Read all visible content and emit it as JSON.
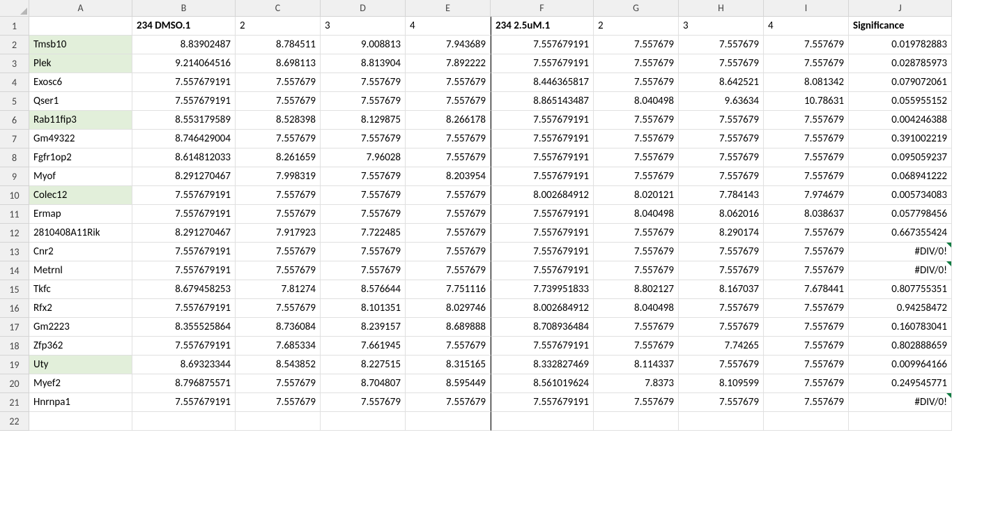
{
  "columns": [
    "A",
    "B",
    "C",
    "D",
    "E",
    "F",
    "G",
    "H",
    "I",
    "J"
  ],
  "headers": {
    "A": "",
    "B": "234 DMSO.1",
    "C": "2",
    "D": "3",
    "E": "4",
    "F": "234 2.5uM.1",
    "G": "2",
    "H": "3",
    "I": "4",
    "J": "Significance"
  },
  "header_bold": [
    "B",
    "F",
    "J"
  ],
  "rows": [
    {
      "n": 2,
      "hl": true,
      "A": "Tmsb10",
      "B": "8.83902487",
      "C": "8.784511",
      "D": "9.008813",
      "E": "7.943689",
      "F": "7.557679191",
      "G": "7.557679",
      "H": "7.557679",
      "I": "7.557679",
      "J": "0.019782883"
    },
    {
      "n": 3,
      "hl": true,
      "A": "Plek",
      "B": "9.214064516",
      "C": "8.698113",
      "D": "8.813904",
      "E": "7.892222",
      "F": "7.557679191",
      "G": "7.557679",
      "H": "7.557679",
      "I": "7.557679",
      "J": "0.028785973"
    },
    {
      "n": 4,
      "A": "Exosc6",
      "B": "7.557679191",
      "C": "7.557679",
      "D": "7.557679",
      "E": "7.557679",
      "F": "8.446365817",
      "G": "7.557679",
      "H": "8.642521",
      "I": "8.081342",
      "J": "0.079072061"
    },
    {
      "n": 5,
      "A": "Qser1",
      "B": "7.557679191",
      "C": "7.557679",
      "D": "7.557679",
      "E": "7.557679",
      "F": "8.865143487",
      "G": "8.040498",
      "H": "9.63634",
      "I": "10.78631",
      "J": "0.055955152"
    },
    {
      "n": 6,
      "hl": true,
      "A": "Rab11fip3",
      "B": "8.553179589",
      "C": "8.528398",
      "D": "8.129875",
      "E": "8.266178",
      "F": "7.557679191",
      "G": "7.557679",
      "H": "7.557679",
      "I": "7.557679",
      "J": "0.004246388"
    },
    {
      "n": 7,
      "A": "Gm49322",
      "B": "8.746429004",
      "C": "7.557679",
      "D": "7.557679",
      "E": "7.557679",
      "F": "7.557679191",
      "G": "7.557679",
      "H": "7.557679",
      "I": "7.557679",
      "J": "0.391002219"
    },
    {
      "n": 8,
      "A": "Fgfr1op2",
      "B": "8.614812033",
      "C": "8.261659",
      "D": "7.96028",
      "E": "7.557679",
      "F": "7.557679191",
      "G": "7.557679",
      "H": "7.557679",
      "I": "7.557679",
      "J": "0.095059237"
    },
    {
      "n": 9,
      "A": "Myof",
      "B": "8.291270467",
      "C": "7.998319",
      "D": "7.557679",
      "E": "8.203954",
      "F": "7.557679191",
      "G": "7.557679",
      "H": "7.557679",
      "I": "7.557679",
      "J": "0.068941222"
    },
    {
      "n": 10,
      "hl": true,
      "A": "Colec12",
      "B": "7.557679191",
      "C": "7.557679",
      "D": "7.557679",
      "E": "7.557679",
      "F": "8.002684912",
      "G": "8.020121",
      "H": "7.784143",
      "I": "7.974679",
      "J": "0.005734083"
    },
    {
      "n": 11,
      "A": "Ermap",
      "B": "7.557679191",
      "C": "7.557679",
      "D": "7.557679",
      "E": "7.557679",
      "F": "7.557679191",
      "G": "8.040498",
      "H": "8.062016",
      "I": "8.038637",
      "J": "0.057798456"
    },
    {
      "n": 12,
      "A": "2810408A11Rik",
      "B": "8.291270467",
      "C": "7.917923",
      "D": "7.722485",
      "E": "7.557679",
      "F": "7.557679191",
      "G": "7.557679",
      "H": "8.290174",
      "I": "7.557679",
      "J": "0.667355424"
    },
    {
      "n": 13,
      "A": "Cnr2",
      "B": "7.557679191",
      "C": "7.557679",
      "D": "7.557679",
      "E": "7.557679",
      "F": "7.557679191",
      "G": "7.557679",
      "H": "7.557679",
      "I": "7.557679",
      "J": "#DIV/0!",
      "flag": true
    },
    {
      "n": 14,
      "A": "Metrnl",
      "B": "7.557679191",
      "C": "7.557679",
      "D": "7.557679",
      "E": "7.557679",
      "F": "7.557679191",
      "G": "7.557679",
      "H": "7.557679",
      "I": "7.557679",
      "J": "#DIV/0!",
      "flag": true
    },
    {
      "n": 15,
      "A": "Tkfc",
      "B": "8.679458253",
      "C": "7.81274",
      "D": "8.576644",
      "E": "7.751116",
      "F": "7.739951833",
      "G": "8.802127",
      "H": "8.167037",
      "I": "7.678441",
      "J": "0.807755351"
    },
    {
      "n": 16,
      "A": "Rfx2",
      "B": "7.557679191",
      "C": "7.557679",
      "D": "8.101351",
      "E": "8.029746",
      "F": "8.002684912",
      "G": "8.040498",
      "H": "7.557679",
      "I": "7.557679",
      "J": "0.94258472"
    },
    {
      "n": 17,
      "A": "Gm2223",
      "B": "8.355525864",
      "C": "8.736084",
      "D": "8.239157",
      "E": "8.689888",
      "F": "8.708936484",
      "G": "7.557679",
      "H": "7.557679",
      "I": "7.557679",
      "J": "0.160783041"
    },
    {
      "n": 18,
      "A": "Zfp362",
      "B": "7.557679191",
      "C": "7.685334",
      "D": "7.661945",
      "E": "7.557679",
      "F": "7.557679191",
      "G": "7.557679",
      "H": "7.74265",
      "I": "7.557679",
      "J": "0.802888659"
    },
    {
      "n": 19,
      "hl": true,
      "A": "Uty",
      "B": "8.69323344",
      "C": "8.543852",
      "D": "8.227515",
      "E": "8.315165",
      "F": "8.332827469",
      "G": "8.114337",
      "H": "7.557679",
      "I": "7.557679",
      "J": "0.009964166"
    },
    {
      "n": 20,
      "A": "Myef2",
      "B": "8.796875571",
      "C": "7.557679",
      "D": "8.704807",
      "E": "8.595449",
      "F": "8.561019624",
      "G": "7.8373",
      "H": "8.109599",
      "I": "7.557679",
      "J": "0.249545771"
    },
    {
      "n": 21,
      "A": "Hnrnpa1",
      "B": "7.557679191",
      "C": "7.557679",
      "D": "7.557679",
      "E": "7.557679",
      "F": "7.557679191",
      "G": "7.557679",
      "H": "7.557679",
      "I": "7.557679",
      "J": "#DIV/0!",
      "flag": true
    }
  ],
  "blank_row": 22
}
